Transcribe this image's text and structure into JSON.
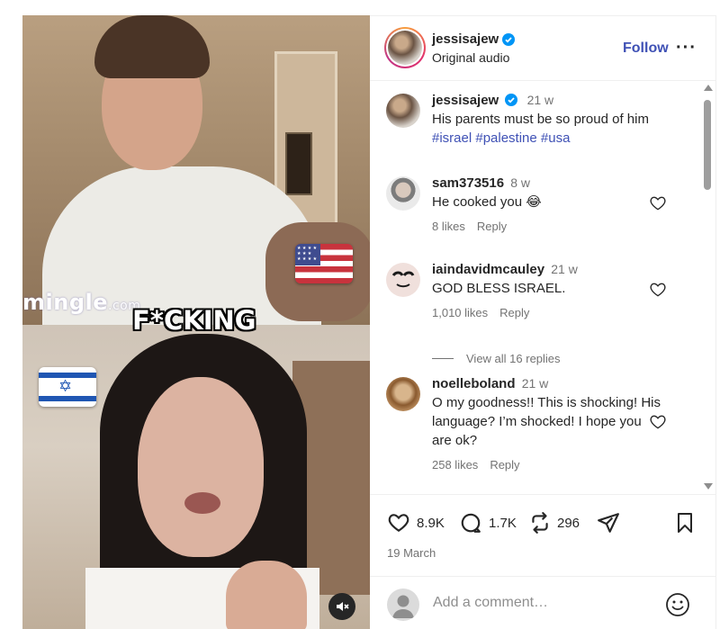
{
  "media": {
    "watermark": "mingle",
    "watermark_suffix": ".com",
    "caption": "F*CKING",
    "flag_top": "us-flag-emoji",
    "flag_bottom": "israel-flag-emoji",
    "mute_icon": "speaker-muted-icon"
  },
  "header": {
    "username": "jessisajew",
    "verified": true,
    "subtitle": "Original audio",
    "follow_label": "Follow",
    "more_label": "···"
  },
  "caption_post": {
    "username": "jessisajew",
    "time": "21 w",
    "text": "His parents must be so proud of him",
    "hashtags": [
      "#israel",
      "#palestine",
      "#usa"
    ]
  },
  "comments": [
    {
      "username": "sam373516",
      "time": "8 w",
      "text": "He cooked you 😂",
      "likes": "8 likes",
      "reply": "Reply"
    },
    {
      "username": "iaindavidmcauley",
      "time": "21 w",
      "text": "GOD BLESS ISRAEL.",
      "likes": "1,010 likes",
      "reply": "Reply",
      "view_replies": "View all 16 replies"
    },
    {
      "username": "noelleboland",
      "time": "21 w",
      "text": "O my goodness!! This is shocking! His language? I’m shocked! I hope you are ok?",
      "likes": "258 likes",
      "reply": "Reply"
    }
  ],
  "actions": {
    "likes_count": "8.9K",
    "comments_count": "1.7K",
    "reposts_count": "296",
    "date": "19 March"
  },
  "add_comment": {
    "placeholder": "Add a comment…"
  },
  "colors": {
    "link_blue": "#3f51b5",
    "verified_blue": "#0095f6",
    "text": "#262626",
    "muted": "#737373"
  }
}
